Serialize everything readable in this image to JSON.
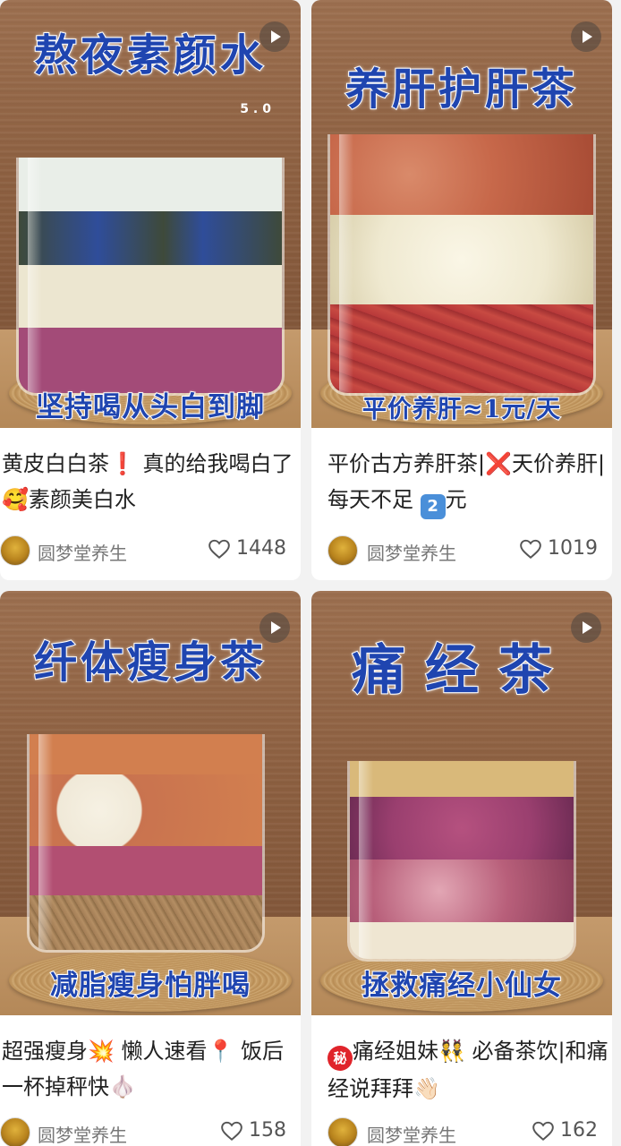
{
  "posts": [
    {
      "headline": "熬夜素颜水",
      "version": "5.0",
      "caption": "坚持喝从头白到脚",
      "title_parts": [
        "黄皮白白茶",
        "❗",
        "真的给我喝白了",
        "🥰",
        "素颜美白水"
      ],
      "author": "圆梦堂养生",
      "likes": "1448",
      "colors": {
        "layers": [
          "#e9eee8",
          "#2f4d9a",
          "#3e4a3a",
          "#ece6d0",
          "#a34b78"
        ]
      }
    },
    {
      "headline": "养肝护肝茶",
      "caption": "平价养肝≈1元/天",
      "title_parts": [
        "平价古方养肝茶|",
        "❌",
        "天价养肝|每天不足",
        "2",
        "元"
      ],
      "author": "圆梦堂养生",
      "likes": "1019",
      "colors": {
        "layers": [
          "#c7684a",
          "#efe9d0",
          "#b8393a"
        ]
      }
    },
    {
      "headline": "纤体瘦身茶",
      "caption": "减脂瘦身怕胖喝",
      "title_parts": [
        "超强瘦身",
        "💥",
        "懒人速看",
        "📍",
        "饭后一杯掉秤快",
        "🧄"
      ],
      "author": "圆梦堂养生",
      "likes": "158",
      "colors": {
        "layers": [
          "#d27f4f",
          "#f0e9d8",
          "#b24f72",
          "#a37d55"
        ]
      }
    },
    {
      "headline": "痛经茶",
      "caption": "拯救痛经小仙女",
      "title_parts": [
        "秘",
        "痛经姐妹",
        "👯",
        "必备茶饮|和痛经说拜拜",
        "👋🏻"
      ],
      "author": "圆梦堂养生",
      "likes": "162",
      "colors": {
        "layers": [
          "#d9b97a",
          "#9a3f6f",
          "#b85f7a",
          "#efe6d2"
        ]
      }
    }
  ],
  "icons": {
    "play": "play-icon",
    "like": "heart-outline-icon"
  }
}
